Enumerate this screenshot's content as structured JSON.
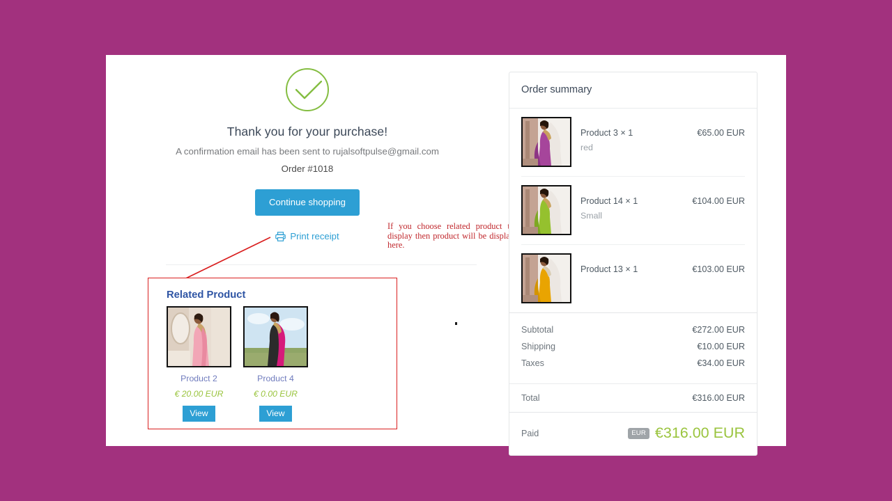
{
  "theme": {
    "background": "#A2317E",
    "accent_blue": "#2d9fd4",
    "accent_green": "#84bd41",
    "annotation_red": "#c0282d",
    "link_blue": "#2f55a4"
  },
  "confirmation": {
    "check_icon": "check-circle-icon",
    "title": "Thank you for your purchase!",
    "email_line": "A confirmation email has been sent to rujalsoftpulse@gmail.com",
    "order_number": "Order #1018",
    "continue_button": "Continue shopping",
    "print_icon": "printer-icon",
    "print_link": "Print receipt"
  },
  "annotation": {
    "text": "If you choose related product to display then product will be display here."
  },
  "related": {
    "title": "Related Product",
    "view_label": "View",
    "products": [
      {
        "name": "Product 2",
        "price": "€ 20.00 EUR",
        "image": "pink-saree-model-thumbnail"
      },
      {
        "name": "Product 4",
        "price": "€ 0.00 EUR",
        "image": "magenta-saree-model-thumbnail"
      }
    ]
  },
  "order_summary": {
    "title": "Order summary",
    "items": [
      {
        "name": "Product 3 × 1",
        "variant": "red",
        "price": "€65.00 EUR",
        "image": "purple-saree-model-thumbnail"
      },
      {
        "name": "Product 14 × 1",
        "variant": "Small",
        "price": "€104.00 EUR",
        "image": "green-saree-model-thumbnail"
      },
      {
        "name": "Product 13 × 1",
        "variant": "",
        "price": "€103.00 EUR",
        "image": "yellow-saree-model-thumbnail"
      }
    ],
    "totals": [
      {
        "label": "Subtotal",
        "value": "€272.00 EUR"
      },
      {
        "label": "Shipping",
        "value": "€10.00 EUR"
      },
      {
        "label": "Taxes",
        "value": "€34.00 EUR"
      }
    ],
    "grand_total": {
      "label": "Total",
      "value": "€316.00 EUR"
    },
    "paid": {
      "label": "Paid",
      "badge": "EUR",
      "amount": "€316.00 EUR"
    }
  }
}
